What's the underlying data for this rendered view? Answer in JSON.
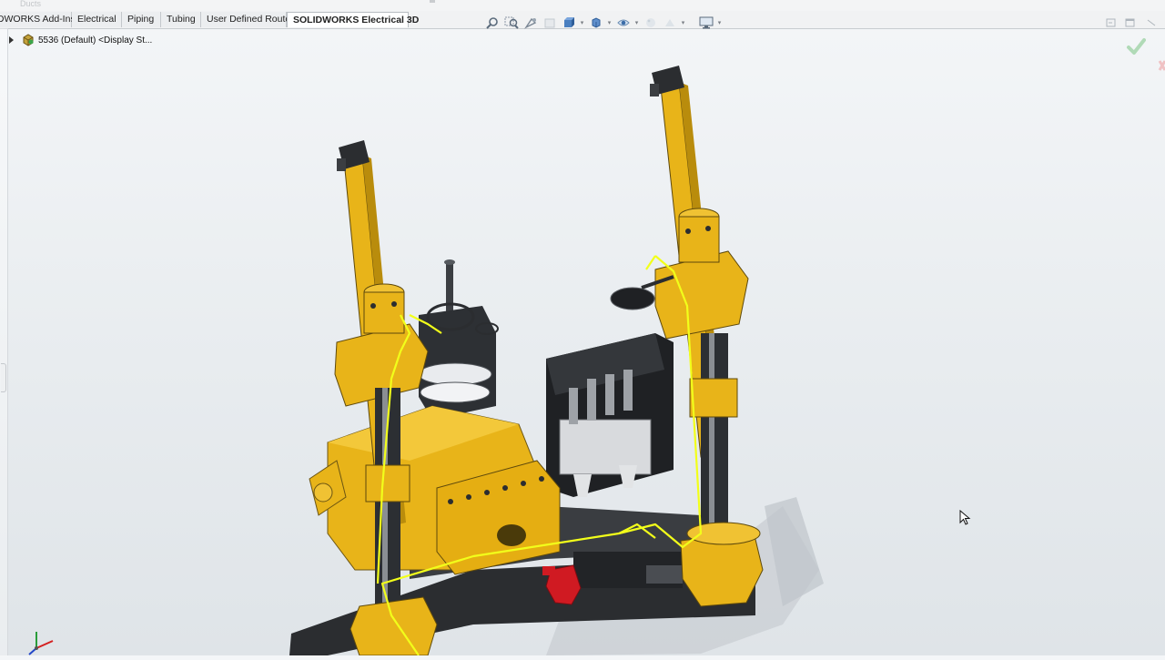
{
  "window": {
    "hidden_tab_hint": "Ducts"
  },
  "command_manager": {
    "tabs": [
      {
        "label": "IDWORKS Add-Ins",
        "active": false
      },
      {
        "label": "Electrical",
        "active": false
      },
      {
        "label": "Piping",
        "active": false
      },
      {
        "label": "Tubing",
        "active": false
      },
      {
        "label": "User Defined Route",
        "active": false
      },
      {
        "label": "SOLIDWORKS Electrical 3D",
        "active": true
      }
    ]
  },
  "view_toolbar": {
    "icons": [
      "zoom-to-fit-icon",
      "zoom-to-area-icon",
      "previous-view-icon",
      "section-view-icon",
      "view-orientation-icon",
      "display-style-icon",
      "hide-show-items-icon",
      "edit-appearance-icon",
      "apply-scene-icon",
      "view-settings-icon"
    ]
  },
  "feature_tree": {
    "root_label": "5536 (Default) <Display St..."
  },
  "confirmation_corner": {
    "accept": "check-icon",
    "cancel": "close-icon"
  },
  "colors": {
    "accent_yellow": "#e8b419",
    "route_line": "#f2ff1a",
    "dark_steel": "#2b2d30",
    "red_shackle": "#d01a22",
    "confirm_green": "#4caf50"
  }
}
